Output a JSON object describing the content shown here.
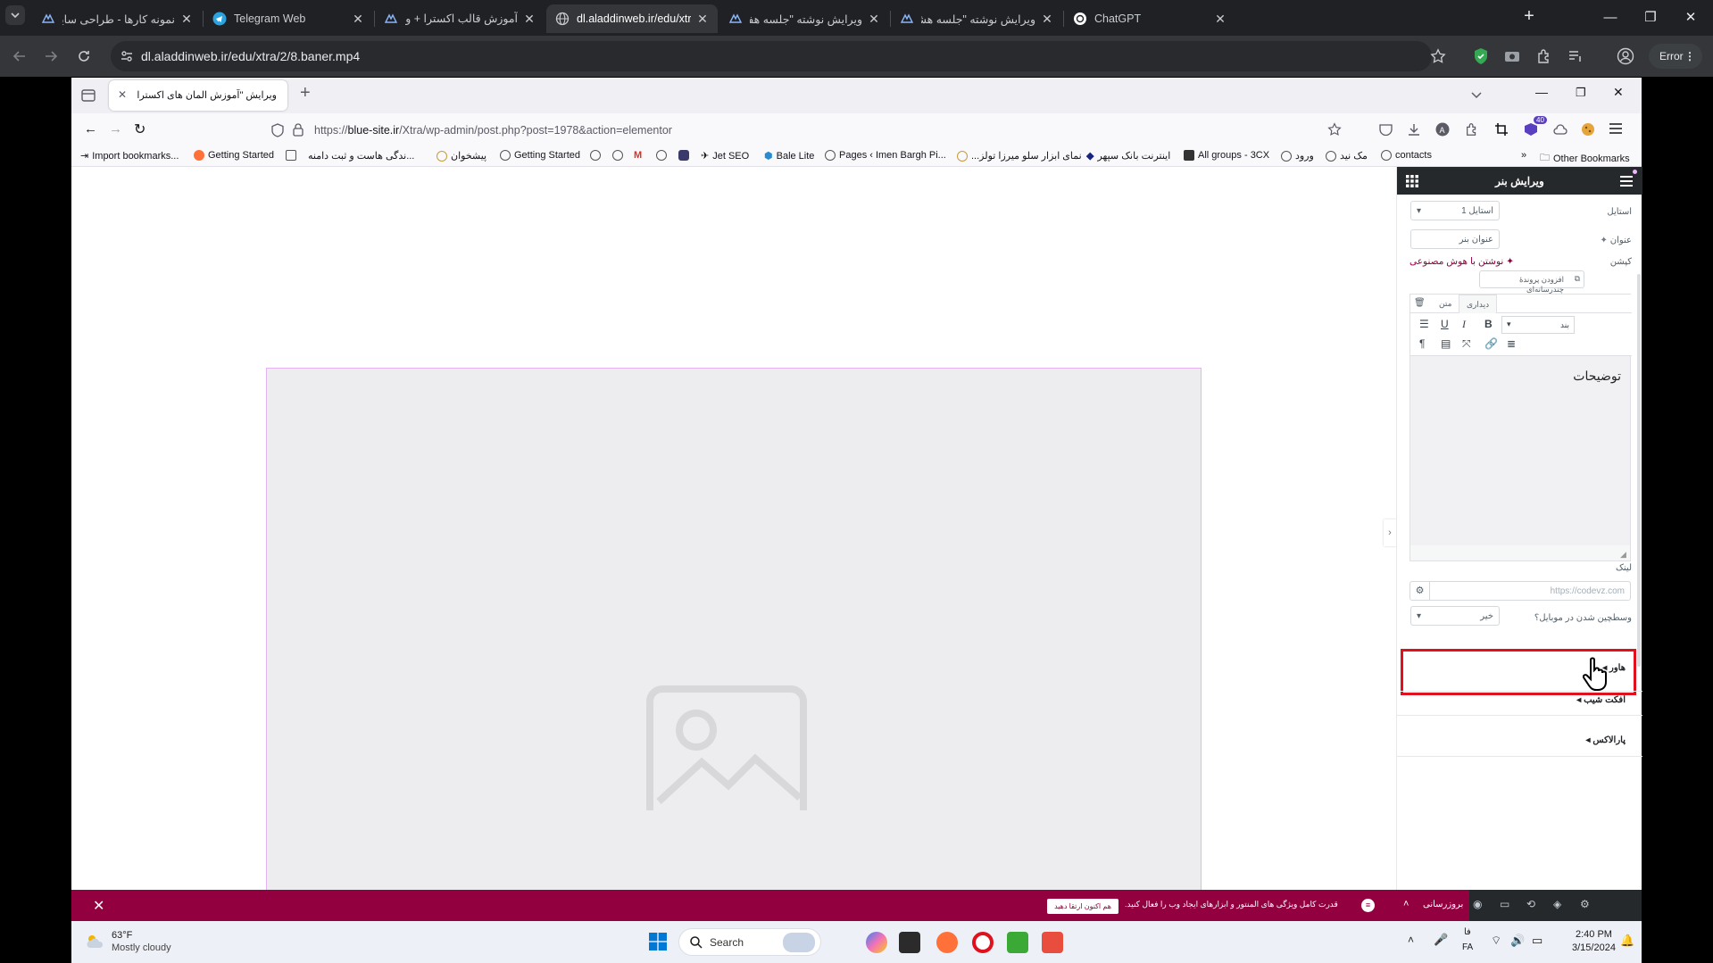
{
  "chrome": {
    "tabs": [
      {
        "label": "نمونه کارها - طراحی سایت علاءال",
        "icon": "elementor-icon"
      },
      {
        "label": "Telegram Web",
        "icon": "telegram-icon"
      },
      {
        "label": "آموزش قالب اکسترا + ویدیو 🏆",
        "icon": "elementor-icon"
      },
      {
        "label": "dl.aladdinweb.ir/edu/xtra/2/8.b",
        "icon": "globe-icon"
      },
      {
        "label": "ویرایش نوشته \"جلسه هفتم-جعبه",
        "icon": "elementor-icon"
      },
      {
        "label": "ویرایش نوشته \"جلسه هشتم-بنر\"",
        "icon": "elementor-icon"
      },
      {
        "label": "ChatGPT",
        "icon": "chatgpt-icon"
      }
    ],
    "url": "dl.aladdinweb.ir/edu/xtra/2/8.baner.mp4",
    "error_label": "Error"
  },
  "firefox": {
    "tab_label": "ویرایش \"آموزش المان های اکسترا - ع",
    "url_prefix": "https://",
    "url_host": "blue-site.ir",
    "url_path": "/Xtra/wp-admin/post.php?post=1978&action=elementor",
    "extension_badge": "40",
    "bookmarks": [
      "Import bookmarks...",
      "Getting Started",
      "...ندگی هاست و ثبت دامنه",
      "پیشخوان",
      "Getting Started",
      "Jet SEO",
      "Bale Lite",
      "Pages ‹ Imen Bargh Pi...",
      "...نمای ابزار سلو میرزا تولز",
      "اینترنت بانک سپهر",
      "All groups - 3CX",
      "ورود",
      "مک نید",
      "contacts"
    ],
    "other_bookmarks": "Other Bookmarks"
  },
  "panel": {
    "title": "ویرایش بنر",
    "style_label": "استایل",
    "style_value": "استایل 1",
    "title_label": "عنوان",
    "title_value": "عنوان بنر",
    "caption_label": "کپشن",
    "ai_link": "نوشتن با هوش مصنوعی",
    "add_media": "افزودن پروندهٔ چندرسانه‌ای",
    "tab_visual": "دیداری",
    "tab_text": "متن",
    "format_value": "بند",
    "editor_text": "توضیحات",
    "link_label": "لینک",
    "link_placeholder": "https://codevz.com",
    "mobile_label": "وسطچین شدن در موبایل؟",
    "mobile_value": "خیر",
    "section_1": "هاور",
    "section_2": "افکت شیب",
    "section_3": "پارالاکس"
  },
  "bottom_bar": {
    "update_button": "بروزرسانی",
    "notice": "قدرت کامل ویژگی های المنتور و ابزارهای ایجاد وب را فعال کنید.",
    "upgrade_button": "هم اکنون ارتقا دهید"
  },
  "taskbar": {
    "temp": "63°F",
    "weather": "Mostly cloudy",
    "search": "Search",
    "lang_1": "فا",
    "lang_2": "FA",
    "time": "2:40 PM",
    "date": "3/15/2024"
  },
  "colors": {
    "chrome_bg": "#202124",
    "accent_magenta": "#93003f",
    "elementor_pink": "#d004d4",
    "highlight_red": "#e0101c"
  }
}
